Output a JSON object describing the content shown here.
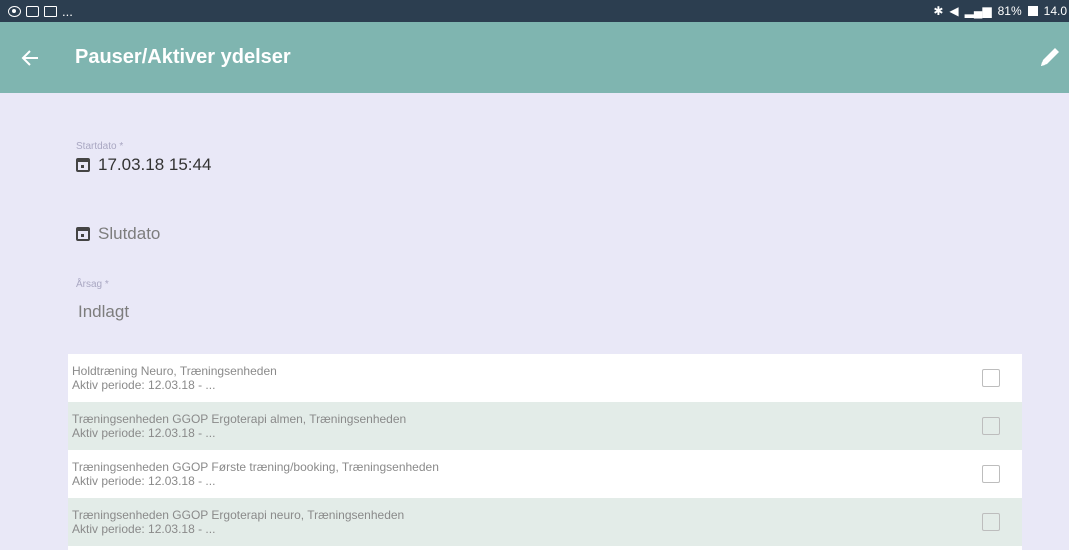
{
  "status_bar": {
    "left_text": "...",
    "right_text": "81%",
    "time": "14.0"
  },
  "app_bar": {
    "title": "Pauser/Aktiver ydelser",
    "back_icon": "arrow-left-icon",
    "edit_icon": "pencil-icon"
  },
  "form": {
    "start_label": "Startdato *",
    "start_value": "17.03.18 15:44",
    "end_value": "Slutdato",
    "reason_label": "Årsag *",
    "reason_value": "Indlagt"
  },
  "services": [
    {
      "title": "Holdtræning Neuro, Træningsenheden",
      "period": "Aktiv periode: 12.03.18 - ..."
    },
    {
      "title": "Træningsenheden GGOP Ergoterapi almen, Træningsenheden",
      "period": "Aktiv periode: 12.03.18 - ..."
    },
    {
      "title": "Træningsenheden GGOP Første træning/booking, Træningsenheden",
      "period": "Aktiv periode: 12.03.18 - ..."
    },
    {
      "title": "Træningsenheden GGOP Ergoterapi neuro, Træningsenheden",
      "period": "Aktiv periode: 12.03.18 - ..."
    }
  ],
  "colors": {
    "app_bar": "#7fb5b0",
    "status_bar": "#2c3e50",
    "background": "#e9e8f7"
  }
}
